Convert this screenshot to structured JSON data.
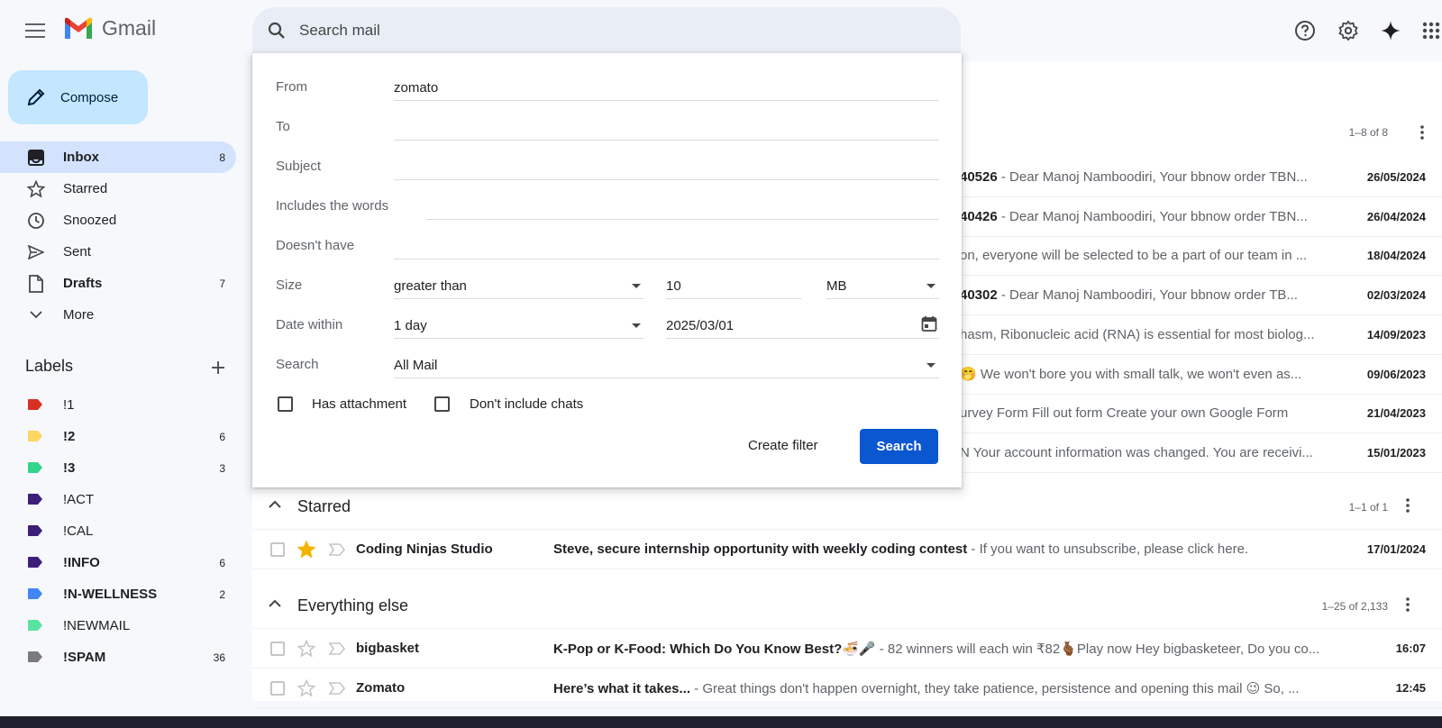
{
  "app": {
    "name": "Gmail"
  },
  "search": {
    "placeholder": "Search mail"
  },
  "compose": {
    "label": "Compose"
  },
  "nav": [
    {
      "label": "Inbox",
      "count": "8",
      "icon": "inbox-icon",
      "bold": true,
      "active": true
    },
    {
      "label": "Starred",
      "count": "",
      "icon": "star-outline-icon"
    },
    {
      "label": "Snoozed",
      "count": "",
      "icon": "clock-icon"
    },
    {
      "label": "Sent",
      "count": "",
      "icon": "send-icon"
    },
    {
      "label": "Drafts",
      "count": "7",
      "icon": "draft-icon",
      "bold": true
    },
    {
      "label": "More",
      "count": "",
      "icon": "chevron-down-icon"
    }
  ],
  "labels": {
    "title": "Labels",
    "items": [
      {
        "name": "!1",
        "count": "",
        "color": "#d93025",
        "bold": false
      },
      {
        "name": "!2",
        "count": "6",
        "color": "#fdd663",
        "bold": true
      },
      {
        "name": "!3",
        "count": "3",
        "color": "#34d48b",
        "bold": true
      },
      {
        "name": "!ACT",
        "count": "",
        "color": "#3c1f78",
        "bold": false
      },
      {
        "name": "!CAL",
        "count": "",
        "color": "#3c1f78",
        "bold": false
      },
      {
        "name": "!INFO",
        "count": "6",
        "color": "#3c1f78",
        "bold": true
      },
      {
        "name": "!N-WELLNESS",
        "count": "2",
        "color": "#4285f4",
        "bold": true
      },
      {
        "name": "!NEWMAIL",
        "count": "",
        "color": "#5be3a2",
        "bold": false
      },
      {
        "name": "!SPAM",
        "count": "36",
        "color": "#7b7b7b",
        "bold": true
      }
    ]
  },
  "advanced_search": {
    "from_label": "From",
    "from_value": "zomato",
    "to_label": "To",
    "to_value": "",
    "subject_label": "Subject",
    "subject_value": "",
    "includes_label": "Includes the words",
    "includes_value": "",
    "doesnt_have_label": "Doesn't have",
    "doesnt_have_value": "",
    "size_label": "Size",
    "size_operator": "greater than",
    "size_value": "10",
    "size_unit": "MB",
    "date_label": "Date within",
    "date_range": "1 day",
    "date_value": "2025/03/01",
    "search_in_label": "Search",
    "search_in_value": "All Mail",
    "has_attachment": "Has attachment",
    "dont_include_chats": "Don't include chats",
    "create_filter": "Create filter",
    "search_button": "Search"
  },
  "primary": {
    "count": "1–8 of 8",
    "rows": [
      {
        "bold": "40526",
        "snippet": " - Dear Manoj Namboodiri, Your bbnow order TBN...",
        "date": "26/05/2024"
      },
      {
        "bold": "40426",
        "snippet": " - Dear Manoj Namboodiri, Your bbnow order TBN...",
        "date": "26/04/2024"
      },
      {
        "bold": "",
        "snippet": "on, everyone will be selected to be a part of our team in ...",
        "date": "18/04/2024"
      },
      {
        "bold": "40302",
        "snippet": " - Dear Manoj Namboodiri, Your bbnow order TB...",
        "date": "02/03/2024"
      },
      {
        "bold": "",
        "snippet": "hasm, Ribonucleic acid (RNA) is essential for most biolog...",
        "date": "14/09/2023"
      },
      {
        "bold": "",
        "snippet": "🤭 We won't bore you with small talk, we won't even as...",
        "date": "09/06/2023"
      },
      {
        "bold": "",
        "snippet": "urvey Form Fill out form Create your own Google Form",
        "date": "21/04/2023"
      },
      {
        "bold": "",
        "snippet": "N Your account information was changed. You are receivi...",
        "date": "15/01/2023"
      }
    ]
  },
  "starred_section": {
    "title": "Starred",
    "count": "1–1 of 1",
    "rows": [
      {
        "sender": "Coding Ninjas Studio",
        "subject": "Steve, secure internship opportunity with weekly coding contest",
        "snippet": " - If you want to unsubscribe, please click here.",
        "date": "17/01/2024",
        "starred": true
      }
    ]
  },
  "else_section": {
    "title": "Everything else",
    "count": "1–25 of 2,133",
    "rows": [
      {
        "sender": "bigbasket",
        "subject": "K-Pop or K-Food: Which Do You Know Best?🍜🎤",
        "snippet": " - 82 winners will each win ₹82🫰🏾Play now Hey bigbasketeer, Do you co...",
        "date": "16:07"
      },
      {
        "sender": "Zomato",
        "subject": "Here’s what it takes...",
        "snippet": " - Great things don't happen overnight, they take patience, persistence and opening this mail 😉 So, ...",
        "date": "12:45"
      }
    ]
  },
  "colors": {
    "accent": "#0b57d0",
    "nav_active": "#d3e3fd",
    "compose": "#c2e7ff",
    "star": "#f4b400"
  }
}
